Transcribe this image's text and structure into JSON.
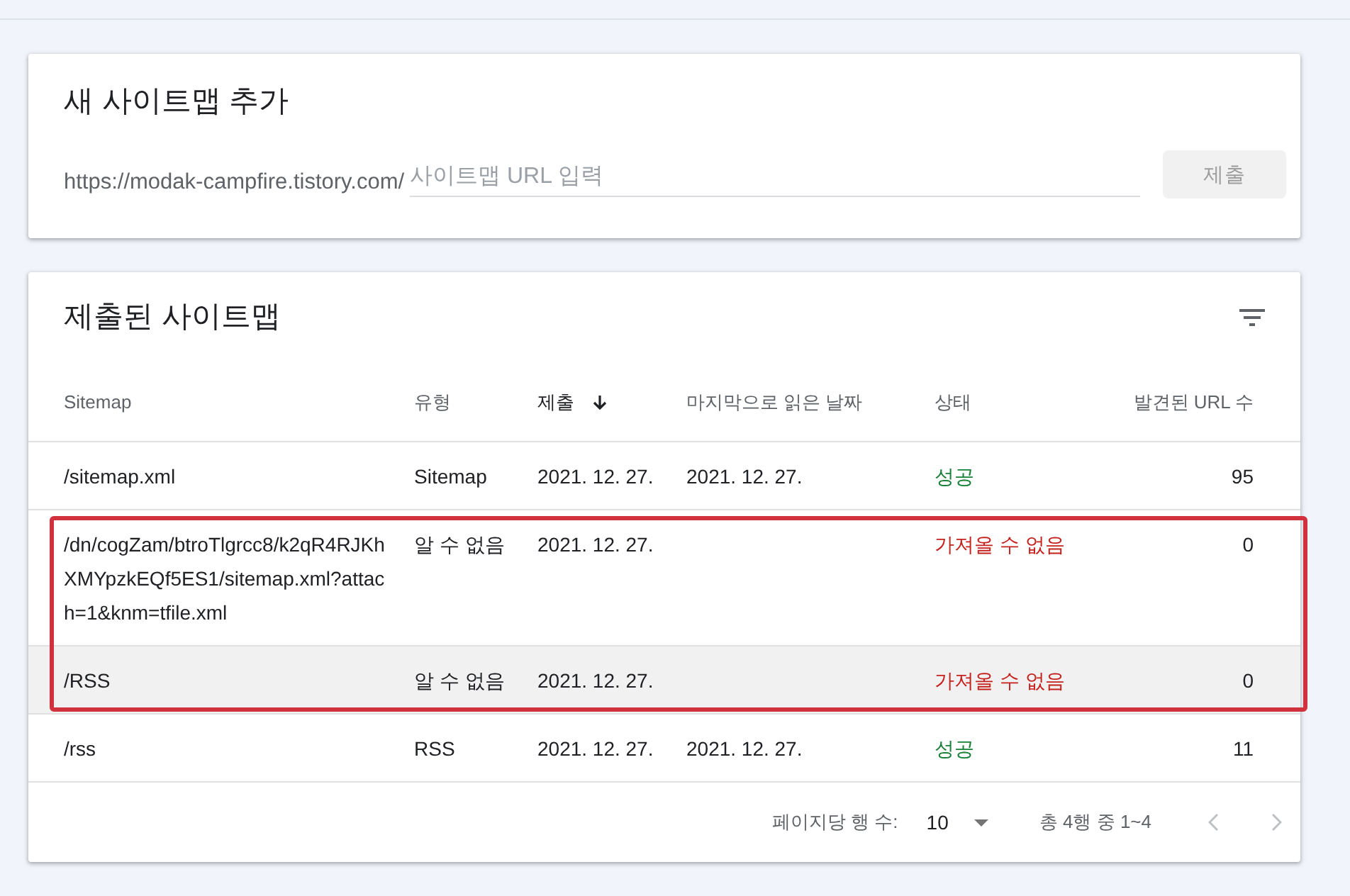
{
  "add_sitemap": {
    "title": "새 사이트맵 추가",
    "url_prefix": "https://modak-campfire.tistory.com/",
    "input": {
      "placeholder": "사이트맵 URL 입력"
    },
    "submit_button": {
      "label": "제출",
      "disabled": true
    }
  },
  "submitted_sitemaps": {
    "title": "제출된 사이트맵",
    "table": {
      "columns": [
        {
          "label": "Sitemap",
          "sorted": false
        },
        {
          "label": "유형",
          "sorted": false
        },
        {
          "label": "제출",
          "sorted": true
        },
        {
          "label": "마지막으로 읽은 날짜",
          "sorted": false
        },
        {
          "label": "상태",
          "sorted": false
        },
        {
          "label": "발견된 URL 수",
          "sorted": false
        }
      ],
      "rows": [
        {
          "sitemap": "/sitemap.xml",
          "type": "Sitemap",
          "submitted": "2021. 12. 27.",
          "last_read": "2021. 12. 27.",
          "status": {
            "text": "성공",
            "color": "#188038"
          },
          "discovered_urls": "95",
          "hovered": false,
          "highlighted": false
        },
        {
          "sitemap": "/dn/cogZam/btroTlgrcc8/k2qR4RJKhXMYpzkEQf5ES1/sitemap.xml?attach=1&knm=tfile.xml",
          "type": "알 수 없음",
          "submitted": "2021. 12. 27.",
          "status": {
            "text": "가져올 수 없음",
            "color": "#c5221f"
          },
          "discovered_urls": "0",
          "hovered": false,
          "highlighted": true
        },
        {
          "sitemap": "/RSS",
          "type": "알 수 없음",
          "submitted": "2021. 12. 27.",
          "status": {
            "text": "가져올 수 없음",
            "color": "#c5221f"
          },
          "discovered_urls": "0",
          "hovered": true,
          "highlighted": true
        },
        {
          "sitemap": "/rss",
          "type": "RSS",
          "submitted": "2021. 12. 27.",
          "last_read": "2021. 12. 27.",
          "status": {
            "text": "성공",
            "color": "#188038"
          },
          "discovered_urls": "11",
          "hovered": false,
          "highlighted": false
        }
      ]
    },
    "pagination": {
      "rows_per_page_label": "페이지당 행 수:",
      "rows_per_page": "10",
      "range": "총 4행 중 1~4",
      "previous": {
        "disabled": true
      },
      "next": {
        "disabled": true
      }
    }
  }
}
